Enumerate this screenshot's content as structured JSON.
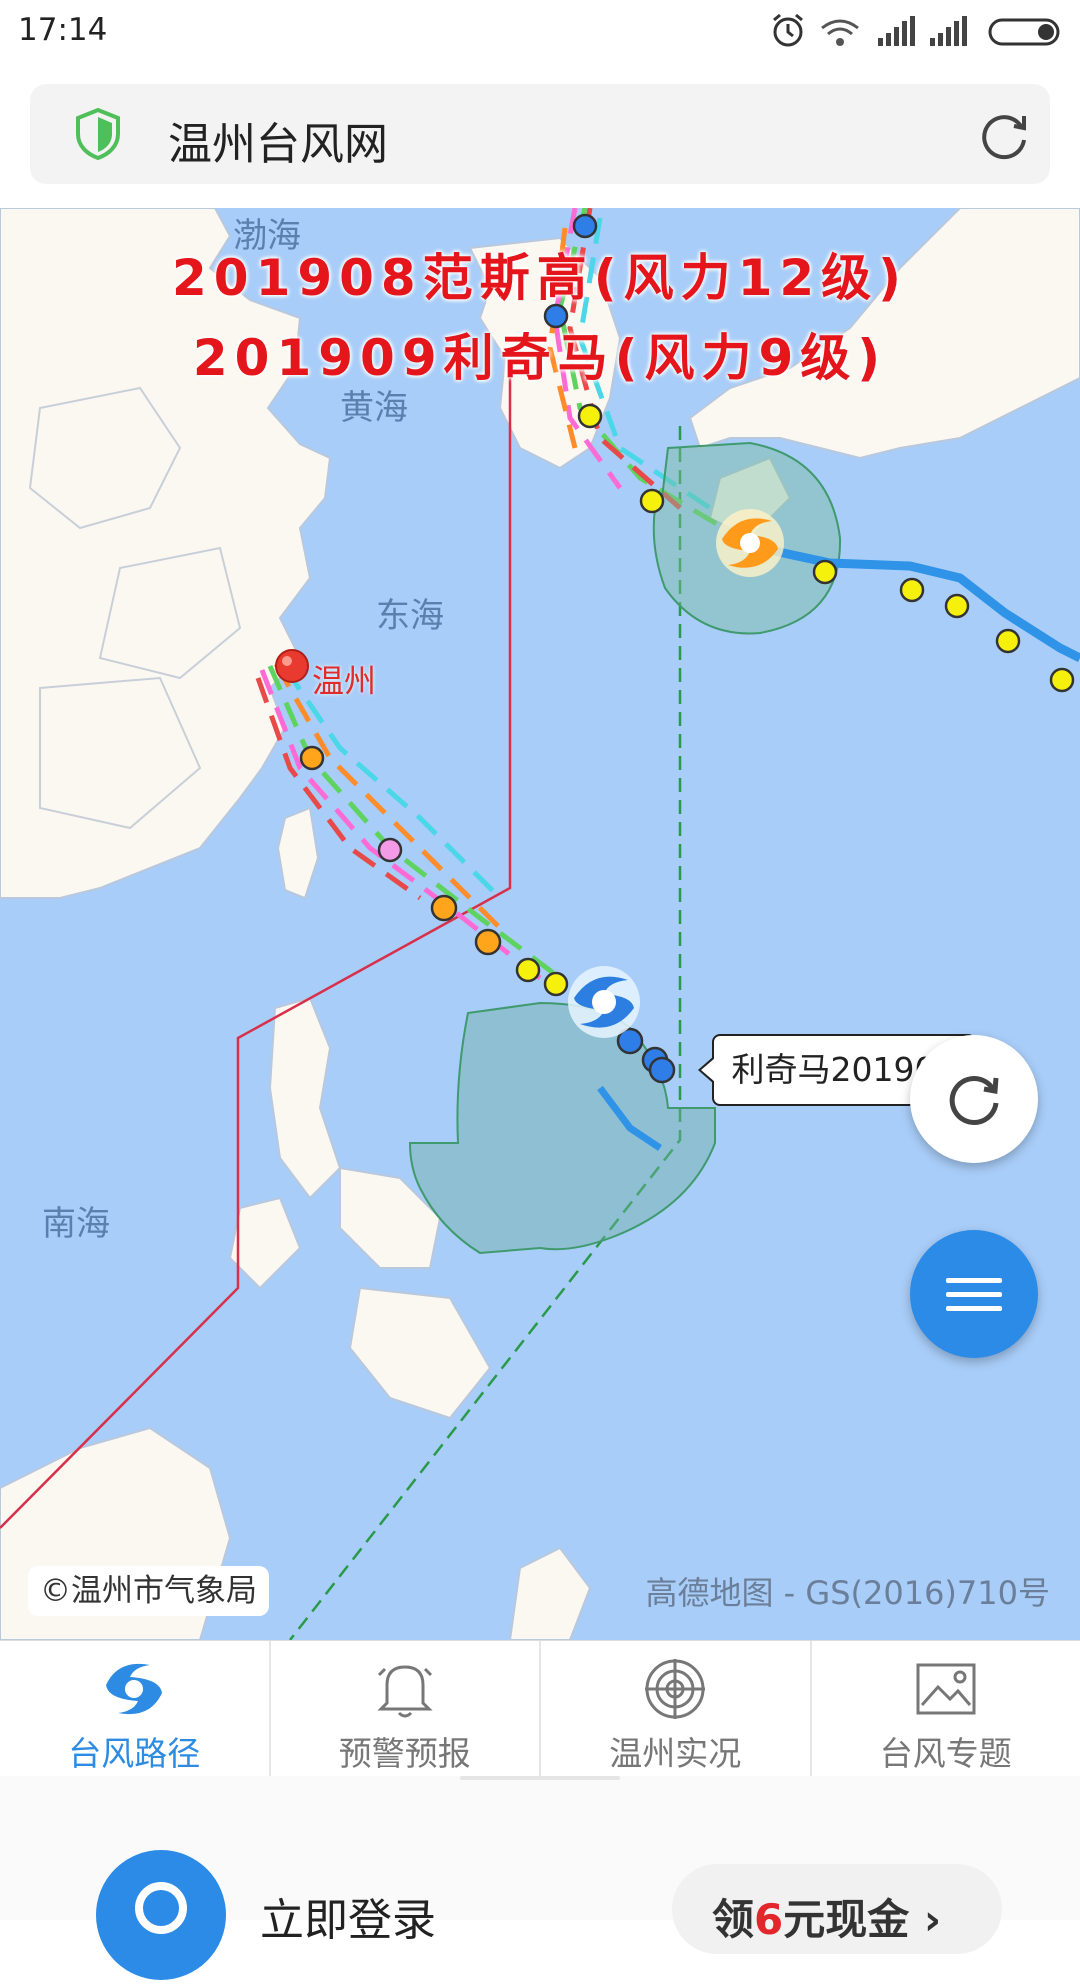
{
  "statusbar": {
    "time": "17:14"
  },
  "browser": {
    "title": "温州台风网"
  },
  "map": {
    "headline_1": "201908范斯高(风力12级)",
    "headline_2": "201909利奇马(风力9级)",
    "labels": {
      "bohai": "渤海",
      "huanghai": "黄海",
      "donghai": "东海",
      "nanhai": "南海",
      "city": "温州"
    },
    "typhoon_tag": "利奇马201909",
    "copyright": "©温州市气象局",
    "attribution": "高德地图 - GS(2016)710号"
  },
  "tabs": [
    {
      "label": "台风路径",
      "icon": "typhoon-icon",
      "active": true
    },
    {
      "label": "预警预报",
      "icon": "bell-icon",
      "active": false
    },
    {
      "label": "温州实况",
      "icon": "radar-icon",
      "active": false
    },
    {
      "label": "台风专题",
      "icon": "image-icon",
      "active": false
    }
  ],
  "footer": {
    "login_text": "立即登录",
    "cash_prefix": "领",
    "cash_number": "6",
    "cash_suffix": "元现金"
  },
  "colors": {
    "accent": "#2b8be6",
    "headline": "#e4161c",
    "sea": "#a8cdf8",
    "land": "#fbf8f2"
  }
}
